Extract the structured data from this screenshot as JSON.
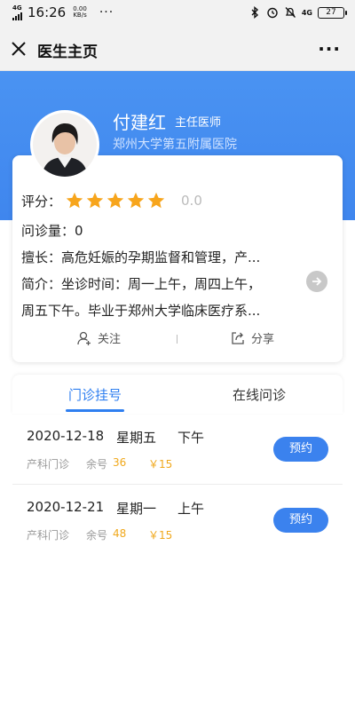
{
  "status_bar": {
    "network": "4G",
    "time": "16:26",
    "speed_value": "0.00",
    "speed_unit": "KB/s",
    "more": "···",
    "network_right": "4G",
    "battery": "27"
  },
  "nav": {
    "title": "医生主页",
    "more": "···"
  },
  "doctor": {
    "name": "付建红",
    "title": "主任医师",
    "hospital": "郑州大学第五附属医院"
  },
  "info": {
    "rating_label": "评分：",
    "rating_stars": 5,
    "rating_value": "0.0",
    "consult_text": "问诊量：0",
    "expertise_text": "擅长：高危妊娠的孕期监督和管理，产...",
    "intro_line1": "简介：坐诊时间：周一上午，周四上午，",
    "intro_line2": "周五下午。毕业于郑州大学临床医疗系...",
    "follow_label": "关注",
    "share_label": "分享"
  },
  "tabs": {
    "clinic": "门诊挂号",
    "online": "在线问诊"
  },
  "schedule": [
    {
      "date": "2020-12-18",
      "weekday": "星期五",
      "half_day": "下午",
      "department": "产科门诊",
      "remain_label": "余号",
      "remain": "36",
      "price": "￥15",
      "button": "预约"
    },
    {
      "date": "2020-12-21",
      "weekday": "星期一",
      "half_day": "上午",
      "department": "产科门诊",
      "remain_label": "余号",
      "remain": "48",
      "price": "￥15",
      "button": "预约"
    }
  ],
  "colors": {
    "brand_blue": "#3f86ee",
    "star_gold": "#f7a51c",
    "price_orange": "#f0a81c",
    "active_tab": "#2f7ff0"
  }
}
